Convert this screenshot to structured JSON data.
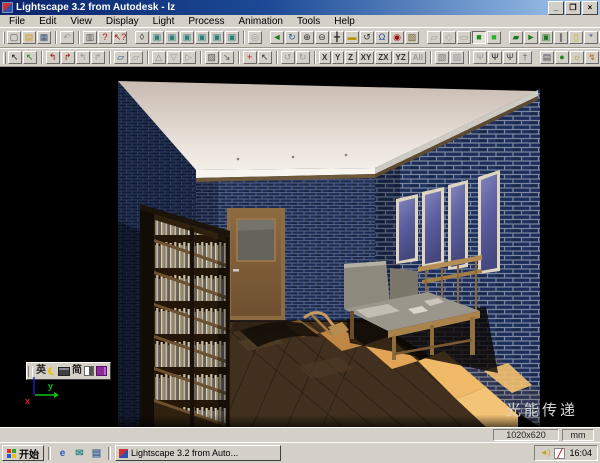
{
  "window": {
    "title": "Lightscape 3.2 from Autodesk - lz",
    "controls": [
      {
        "name": "minimize-button",
        "g": "_"
      },
      {
        "name": "restore-button",
        "g": "❐"
      },
      {
        "name": "close-button",
        "g": "×"
      }
    ]
  },
  "menu": {
    "items": [
      "File",
      "Edit",
      "View",
      "Display",
      "Light",
      "Process",
      "Animation",
      "Tools",
      "Help"
    ]
  },
  "toolbar_row1": {
    "items": [
      {
        "name": "new-button",
        "g": "▢",
        "c": "#555555"
      },
      {
        "name": "open-button",
        "g": "▤",
        "c": "#c8981c"
      },
      {
        "name": "save-button",
        "g": "▦",
        "c": "#39507e"
      },
      {
        "cls": "sep"
      },
      {
        "name": "undo-button",
        "g": "↶",
        "cls": "dis"
      },
      {
        "cls": "sep"
      },
      {
        "name": "print-button",
        "g": "▥",
        "c": "#555555"
      },
      {
        "name": "help-button",
        "g": "?",
        "c": "#a01010"
      },
      {
        "name": "context-help-button",
        "g": "↖?",
        "c": "#a01010"
      },
      {
        "cls": "gap"
      },
      {
        "name": "key-tool-button",
        "g": "◊",
        "c": "#333333"
      },
      {
        "name": "view-preset-1-button",
        "g": "▣",
        "c": "#2e7d7d"
      },
      {
        "name": "view-preset-2-button",
        "g": "▣",
        "c": "#2e7d7d"
      },
      {
        "name": "view-preset-3-button",
        "g": "▣",
        "c": "#2e7d7d"
      },
      {
        "name": "view-preset-4-button",
        "g": "▣",
        "c": "#2e7d7d"
      },
      {
        "name": "view-preset-5-button",
        "g": "▣",
        "c": "#2e7d7d"
      },
      {
        "name": "view-preset-6-button",
        "g": "▣",
        "c": "#2e7d7d"
      },
      {
        "cls": "sep"
      },
      {
        "name": "zoom-extents-button",
        "g": "◎",
        "cls": "dis"
      },
      {
        "cls": "gap"
      },
      {
        "name": "previous-view-button",
        "g": "◄",
        "c": "#1c7a1c"
      },
      {
        "name": "redraw-button",
        "g": "↻",
        "c": "#2a5aa0"
      },
      {
        "name": "zoom-in-button",
        "g": "⊕",
        "c": "#333333"
      },
      {
        "name": "zoom-out-button",
        "g": "⊖",
        "c": "#333333"
      },
      {
        "name": "pan-button",
        "g": "╋",
        "c": "#333333"
      },
      {
        "name": "level-tool-button",
        "g": "▬",
        "c": "#b8960a"
      },
      {
        "name": "rotate-view-button",
        "g": "↺",
        "c": "#333333"
      },
      {
        "name": "orbit-button",
        "g": "Ω",
        "c": "#2a4a9a"
      },
      {
        "name": "zoom-window-button",
        "g": "◉",
        "c": "#a01010"
      },
      {
        "name": "restore-view-button",
        "g": "▧",
        "c": "#6b5a2a"
      },
      {
        "cls": "gap"
      },
      {
        "name": "wireframe-mode-button",
        "g": "▱",
        "cls": "dis"
      },
      {
        "name": "hidden-line-mode-button",
        "g": "◇",
        "cls": "dis"
      },
      {
        "name": "outline-mode-button",
        "g": "▭",
        "cls": "dis"
      },
      {
        "name": "shaded-mode-button",
        "g": "■",
        "c": "#1e8a1e",
        "cls": "pressed"
      },
      {
        "name": "enhanced-mode-button",
        "g": "■",
        "c": "#27b427"
      },
      {
        "cls": "gap"
      },
      {
        "name": "initiate-button",
        "g": "▰",
        "c": "#1e7a1e"
      },
      {
        "name": "go-button",
        "g": "►",
        "c": "#1e7a1e"
      },
      {
        "name": "update-button",
        "g": "▣",
        "c": "#1e7a1e"
      },
      {
        "name": "draft-button",
        "g": "∥",
        "c": "#444444"
      },
      {
        "name": "snapshot-button",
        "g": "▯",
        "c": "#c8b400"
      },
      {
        "name": "raytrace-button",
        "g": "*",
        "c": "#2a4ab0"
      },
      {
        "name": "filter-button",
        "g": "▦",
        "cls": "dis"
      },
      {
        "name": "render-button",
        "g": "◉",
        "c": "#1e7a1e"
      }
    ]
  },
  "toolbar_row2": {
    "items": [
      {
        "name": "select-button",
        "g": "↖",
        "c": "#111111"
      },
      {
        "name": "select-query-button",
        "g": "↖",
        "c": "#1e7a1e"
      },
      {
        "cls": "sep"
      },
      {
        "name": "select-surface-button",
        "g": "↰",
        "c": "#a01010"
      },
      {
        "name": "select-patch-button",
        "g": "↱",
        "c": "#a01010"
      },
      {
        "name": "select-source-button",
        "g": "↰",
        "cls": "dis"
      },
      {
        "name": "select-occluder-button",
        "g": "↱",
        "cls": "dis"
      },
      {
        "cls": "sep"
      },
      {
        "name": "query-entity-button",
        "g": "▱",
        "c": "#2a5aa0"
      },
      {
        "name": "query-surface-button",
        "g": "▱",
        "cls": "dis"
      },
      {
        "cls": "sep"
      },
      {
        "name": "orient-face-button",
        "g": "△",
        "c": "#888888"
      },
      {
        "name": "align-face-button",
        "g": "▽",
        "cls": "dis"
      },
      {
        "name": "flip-normal-button",
        "g": "▷",
        "cls": "dis"
      },
      {
        "cls": "sep"
      },
      {
        "name": "mesh-tool-button",
        "g": "▨",
        "c": "#555555"
      },
      {
        "name": "pick-tool-button",
        "g": "↘",
        "c": "#555555"
      },
      {
        "cls": "sep"
      },
      {
        "name": "add-light-button",
        "g": "+",
        "c": "#c01010"
      },
      {
        "name": "select-object-button",
        "g": "↖",
        "c": "#333333"
      },
      {
        "cls": "sep"
      },
      {
        "name": "undo-view-button",
        "g": "↺",
        "cls": "dis"
      },
      {
        "name": "redo-view-button",
        "g": "↻",
        "cls": "dis"
      },
      {
        "cls": "sep"
      },
      {
        "name": "lock-x-button",
        "g": "X",
        "cls": "txt"
      },
      {
        "name": "lock-y-button",
        "g": "Y",
        "cls": "txt"
      },
      {
        "name": "lock-z-button",
        "g": "Z",
        "cls": "txt"
      },
      {
        "name": "lock-xy-button",
        "g": "XY",
        "cls": "txt"
      },
      {
        "name": "lock-zx-button",
        "g": "ZX",
        "cls": "txt"
      },
      {
        "name": "lock-yz-button",
        "g": "YZ",
        "cls": "txt"
      },
      {
        "name": "lock-all-button",
        "g": "All",
        "cls": "txt dis"
      },
      {
        "cls": "sep"
      },
      {
        "name": "snap-tool-button",
        "g": "▧",
        "c": "#777777"
      },
      {
        "name": "vertex-snap-button",
        "g": "▨",
        "cls": "dis"
      },
      {
        "cls": "sep"
      },
      {
        "name": "walk-mode-button",
        "g": "Ψ",
        "cls": "dis"
      },
      {
        "name": "run-mode-button",
        "g": "Ψ",
        "c": "#222222"
      },
      {
        "name": "fly-mode-button",
        "g": "Ψ",
        "c": "#444444"
      },
      {
        "name": "stand-mode-button",
        "g": "†",
        "c": "#666666"
      },
      {
        "cls": "gap"
      },
      {
        "name": "layers-button",
        "g": "▤",
        "c": "#444455"
      },
      {
        "name": "solution-stage-button",
        "g": "●",
        "c": "#1e8a1e"
      },
      {
        "name": "daylight-button",
        "g": "☼",
        "c": "#b09a10"
      },
      {
        "name": "process-control-button",
        "g": "↯",
        "c": "#c06a10"
      }
    ]
  },
  "viewport": {
    "watermark": "光能传递",
    "ime": {
      "lang": "英",
      "charset": "简"
    },
    "axis": {
      "x": "x",
      "y": "y"
    }
  },
  "status_bar": {
    "resolution": "1020x620",
    "units": "mm"
  },
  "taskbar": {
    "start_label": "开始",
    "quick_launch": [
      {
        "name": "ie-icon",
        "g": "e",
        "c": "#2858c8"
      },
      {
        "name": "mail-icon",
        "g": "✉",
        "c": "#2a8a8a"
      },
      {
        "name": "show-desktop-icon",
        "g": "▤",
        "c": "#4a6a9a"
      }
    ],
    "task_label": "Lightscape 3.2 from Auto...",
    "tray_time": "16:04"
  },
  "colors": {
    "chrome": "#d4d0c8",
    "titlebar_left": "#0a246a",
    "titlebar_right": "#a6caf0",
    "brick": "#1b2b52",
    "mortar": "#7e87a0",
    "accent_green": "#1e7a1e"
  }
}
